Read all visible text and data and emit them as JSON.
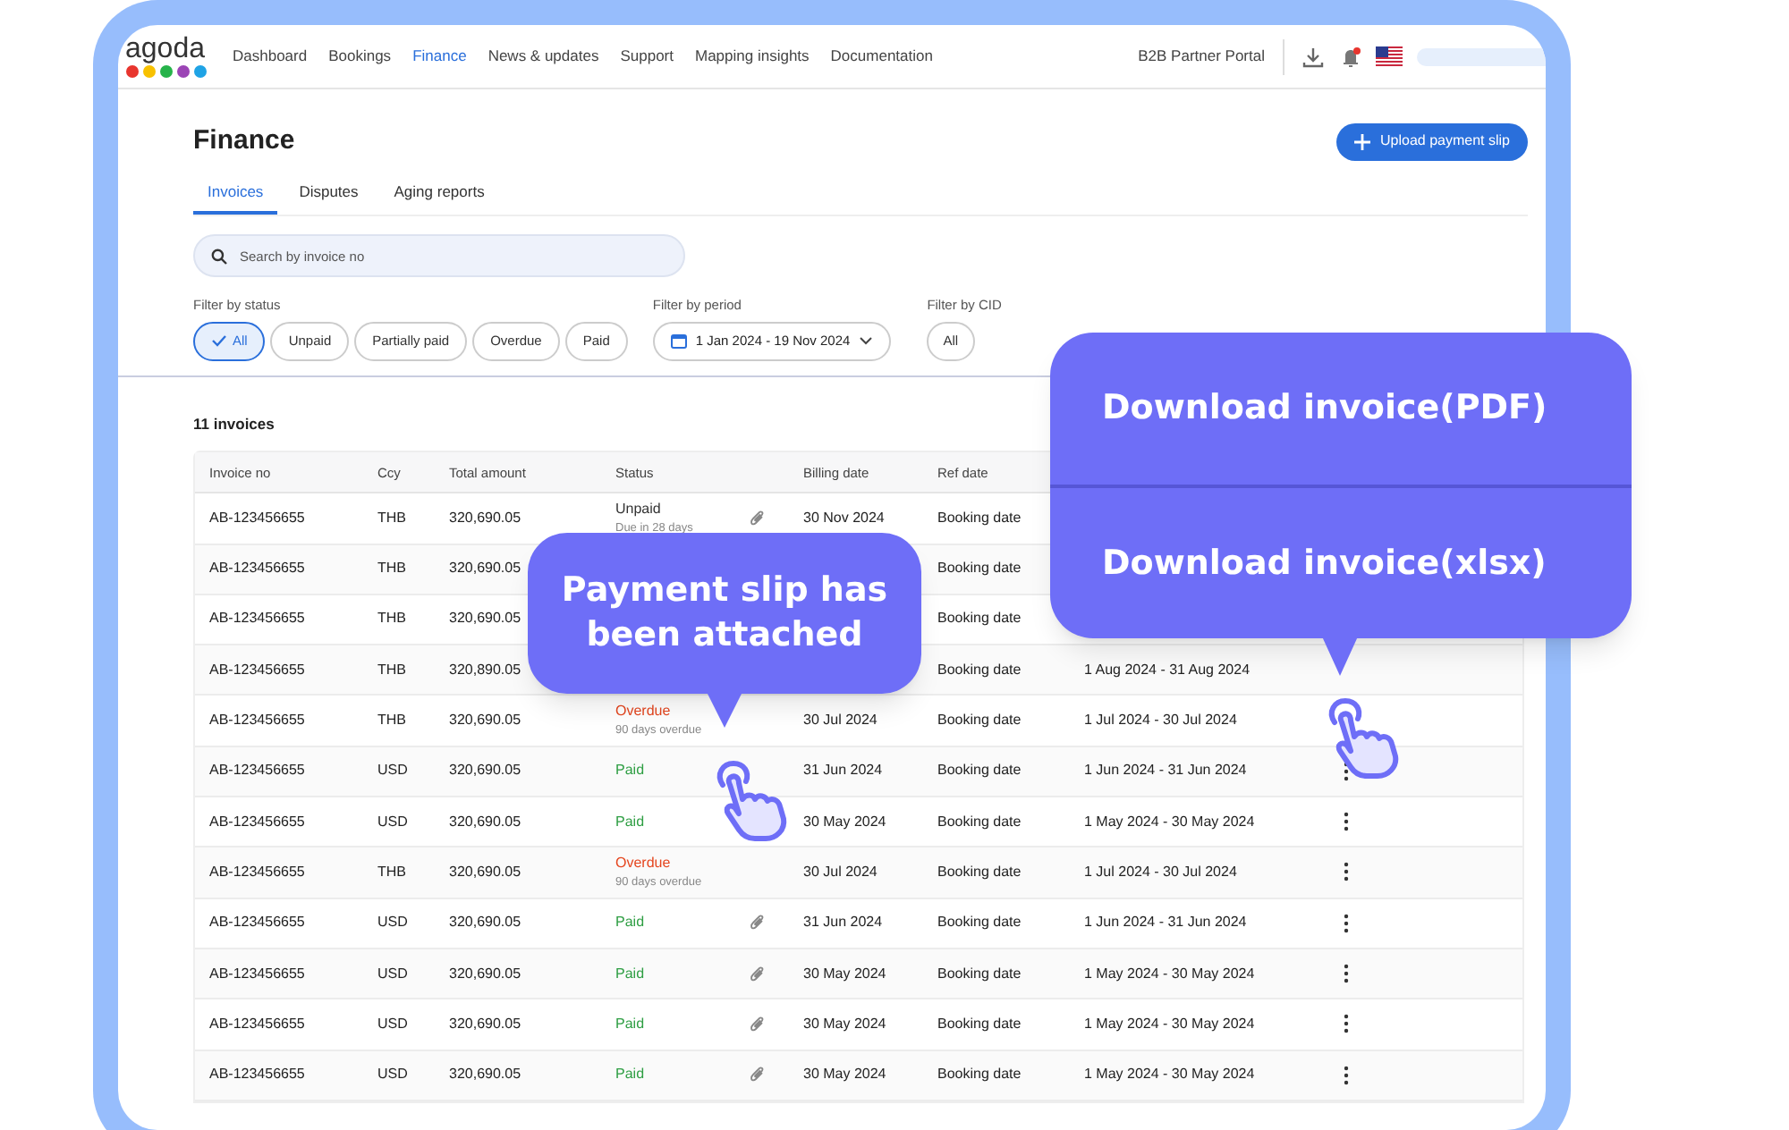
{
  "nav": {
    "logo": "agoda",
    "items": [
      {
        "label": "Dashboard",
        "selected": false
      },
      {
        "label": "Bookings",
        "selected": false
      },
      {
        "label": "Finance",
        "selected": true
      },
      {
        "label": "News & updates",
        "selected": false
      },
      {
        "label": "Support",
        "selected": false
      },
      {
        "label": "Mapping insights",
        "selected": false
      },
      {
        "label": "Documentation",
        "selected": false
      }
    ],
    "portal": "B2B Partner Portal"
  },
  "page": {
    "title": "Finance",
    "upload_button": "Upload payment slip"
  },
  "tabs": [
    {
      "label": "Invoices",
      "selected": true
    },
    {
      "label": "Disputes",
      "selected": false
    },
    {
      "label": "Aging reports",
      "selected": false
    }
  ],
  "search": {
    "placeholder": "Search by invoice no"
  },
  "filters": {
    "status": {
      "label": "Filter by status",
      "options": [
        {
          "label": "All",
          "selected": true
        },
        {
          "label": "Unpaid",
          "selected": false
        },
        {
          "label": "Partially paid",
          "selected": false
        },
        {
          "label": "Overdue",
          "selected": false
        },
        {
          "label": "Paid",
          "selected": false
        }
      ]
    },
    "period": {
      "label": "Filter by period",
      "value": "1 Jan 2024 - 19 Nov 2024"
    },
    "cid": {
      "label": "Filter by CID",
      "options": [
        {
          "label": "All",
          "selected": false
        }
      ]
    }
  },
  "invoice_count": "11 invoices",
  "table": {
    "columns": [
      "Invoice no",
      "Ccy",
      "Total amount",
      "Status",
      "Billing date",
      "Ref date"
    ],
    "rows": [
      {
        "invoice": "AB-123456655",
        "ccy": "THB",
        "amount": "320,690.05",
        "status": {
          "kind": "unpaid",
          "label": "Unpaid",
          "note": "Due in 28 days"
        },
        "attachment": true,
        "billing": "30 Nov 2024",
        "ref": "Booking date"
      },
      {
        "invoice": "AB-123456655",
        "ccy": "THB",
        "amount": "320,690.05",
        "ref": "Booking date"
      },
      {
        "invoice": "AB-123456655",
        "ccy": "THB",
        "amount": "320,690.05",
        "ref": "Booking date"
      },
      {
        "invoice": "AB-123456655",
        "ccy": "THB",
        "amount": "320,890.05",
        "ref": "Booking date",
        "period": "1 Aug 2024 - 31 Aug 2024"
      },
      {
        "invoice": "AB-123456655",
        "ccy": "THB",
        "amount": "320,690.05",
        "status": {
          "kind": "overdue",
          "label": "Overdue",
          "note": "90 days overdue"
        },
        "attachment": false,
        "billing": "30 Jul 2024",
        "ref": "Booking date",
        "period": "1 Jul 2024 - 30 Jul 2024"
      },
      {
        "invoice": "AB-123456655",
        "ccy": "USD",
        "amount": "320,690.05",
        "status": {
          "kind": "paid",
          "label": "Paid"
        },
        "billing": "31 Jun 2024",
        "ref": "Booking date",
        "period": "1 Jun 2024 - 31 Jun 2024",
        "menu": true
      },
      {
        "invoice": "AB-123456655",
        "ccy": "USD",
        "amount": "320,690.05",
        "status": {
          "kind": "paid",
          "label": "Paid"
        },
        "billing": "30 May 2024",
        "ref": "Booking date",
        "period": "1 May 2024 - 30 May 2024",
        "menu": true
      },
      {
        "invoice": "AB-123456655",
        "ccy": "THB",
        "amount": "320,690.05",
        "status": {
          "kind": "overdue",
          "label": "Overdue",
          "note": "90 days overdue"
        },
        "attachment": false,
        "billing": "30 Jul 2024",
        "ref": "Booking date",
        "period": "1 Jul 2024 - 30 Jul 2024",
        "menu": true
      },
      {
        "invoice": "AB-123456655",
        "ccy": "USD",
        "amount": "320,690.05",
        "status": {
          "kind": "paid",
          "label": "Paid"
        },
        "attachment": true,
        "billing": "31 Jun 2024",
        "ref": "Booking date",
        "period": "1 Jun 2024 - 31 Jun 2024",
        "menu": true
      },
      {
        "invoice": "AB-123456655",
        "ccy": "USD",
        "amount": "320,690.05",
        "status": {
          "kind": "paid",
          "label": "Paid"
        },
        "attachment": true,
        "billing": "30 May 2024",
        "ref": "Booking date",
        "period": "1 May 2024 - 30 May 2024",
        "menu": true
      },
      {
        "invoice": "AB-123456655",
        "ccy": "USD",
        "amount": "320,690.05",
        "status": {
          "kind": "paid",
          "label": "Paid"
        },
        "attachment": true,
        "billing": "30 May 2024",
        "ref": "Booking date",
        "period": "1 May 2024 - 30 May 2024",
        "menu": true
      },
      {
        "invoice": "AB-123456655",
        "ccy": "USD",
        "amount": "320,690.05",
        "status": {
          "kind": "paid",
          "label": "Paid"
        },
        "attachment": true,
        "billing": "30 May 2024",
        "ref": "Booking date",
        "period": "1 May 2024 - 30 May 2024",
        "menu": true
      }
    ]
  },
  "callout": {
    "text": "Payment slip has been attached"
  },
  "download_menu": {
    "items": [
      "Download invoice(PDF)",
      "Download invoice(xlsx)"
    ]
  }
}
